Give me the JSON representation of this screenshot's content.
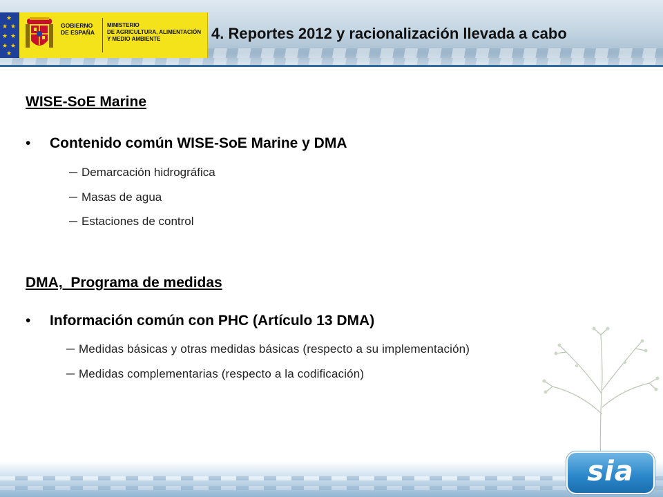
{
  "header": {
    "gov_name_lines": [
      "GOBIERNO",
      "DE ESPAÑA"
    ],
    "ministry_lines": [
      "MINISTERIO",
      "DE AGRICULTURA, ALIMENTACIÓN",
      "Y MEDIO AMBIENTE"
    ],
    "title": "4. Reportes 2012 y racionalización llevada a cabo"
  },
  "sections": [
    {
      "heading": "WISE-SoE Marine",
      "bullet": "Contenido común WISE-SoE Marine y DMA",
      "subitems": [
        "Demarcación hidrográfica",
        "Masas de agua",
        "Estaciones de control"
      ]
    },
    {
      "heading": "DMA,  Programa de medidas",
      "bullet": "Información común con PHC (Artículo 13 DMA)",
      "subitems": [
        "Medidas básicas y otras medidas básicas (respecto a su implementación)",
        "Medidas complementarias (respecto a la codificación)"
      ]
    }
  ],
  "symbols": {
    "bullet": "•",
    "dash": "─"
  },
  "footer": {
    "logo_text": "sia"
  },
  "colors": {
    "gov_yellow": "#f4e21a",
    "eu_blue": "#1e3f9a",
    "header_line": "#2f6aa0",
    "logo_blue": "#2a86c9"
  }
}
